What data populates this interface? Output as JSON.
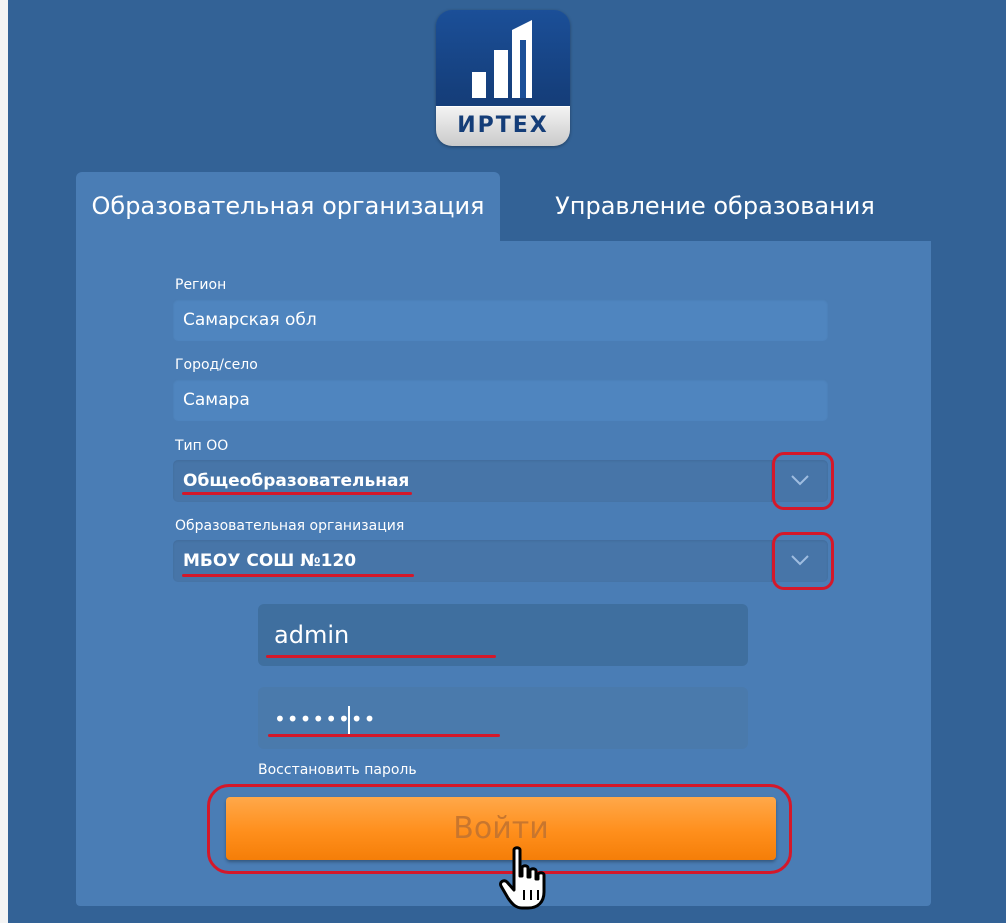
{
  "logo": {
    "text": "ИРТЕХ"
  },
  "tabs": [
    {
      "label": "Образовательная организация",
      "active": true
    },
    {
      "label": "Управление образования",
      "active": false
    }
  ],
  "form": {
    "region": {
      "label": "Регион",
      "value": "Самарская обл"
    },
    "city": {
      "label": "Город/село",
      "value": "Самара"
    },
    "org_type": {
      "label": "Тип ОО",
      "value": "Общеобразовательная"
    },
    "org": {
      "label": "Образовательная организация",
      "value": "МБОУ СОШ №120"
    },
    "login": {
      "value": "admin"
    },
    "password": {
      "value": "••••••••"
    },
    "restore_link": "Восстановить пароль",
    "submit_label": "Войти"
  },
  "colors": {
    "background": "#336296",
    "panel": "#4a7db5",
    "button": "#ff8f1c",
    "highlight": "#d4182a"
  },
  "icons": [
    "chevron-down-icon",
    "hand-pointer-icon",
    "logo-icon"
  ]
}
